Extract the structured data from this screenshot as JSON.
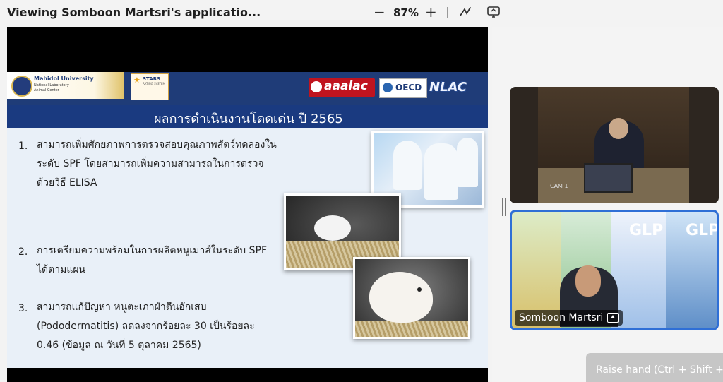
{
  "window": {
    "title": "Viewing Somboon Martsri's applicatio...",
    "zoom_minus": "−",
    "zoom_value": "87%",
    "zoom_plus": "+"
  },
  "slide": {
    "mu_name": "Mahidol University",
    "mu_sub1": "National Laboratory",
    "mu_sub2": "Animal Center",
    "stars_title": "STARS",
    "stars_sub": "RATING SYSTEM",
    "aaalac": "aaalac",
    "oecd": "OECD",
    "nlac": "NLAC",
    "heading": "ผลการดำเนินงานโดดเด่น ปี 2565",
    "items": [
      {
        "num": "1.",
        "lines": [
          "สามารถเพิ่มศักยภาพการตรวจสอบคุณภาพสัตว์ทดลองใน",
          "ระดับ SPF โดยสามารถเพิ่มความสามารถในการตรวจ",
          "ด้วยวิธี ELISA"
        ]
      },
      {
        "num": "2.",
        "lines": [
          "การเตรียมความพร้อมในการผลิตหนูเมาส์ในระดับ SPF",
          "ได้ตามแผน"
        ]
      },
      {
        "num": "3.",
        "lines": [
          "สามารถแก้ปัญหา หนูตะเภาฝ่าตีนอักเสบ",
          "(Pododermatitis) ลดลงจากร้อยละ 30 เป็นร้อยละ",
          "0.46 (ข้อมูล ณ วันที่ 5 ตุลาคม 2565)"
        ]
      }
    ]
  },
  "participants": {
    "cam_label": "CAM 1",
    "glp1": "GLP",
    "glp2": "GLP",
    "presenter_name": "Somboon Martsri"
  },
  "toast": {
    "text": "Raise hand (Ctrl + Shift +"
  }
}
